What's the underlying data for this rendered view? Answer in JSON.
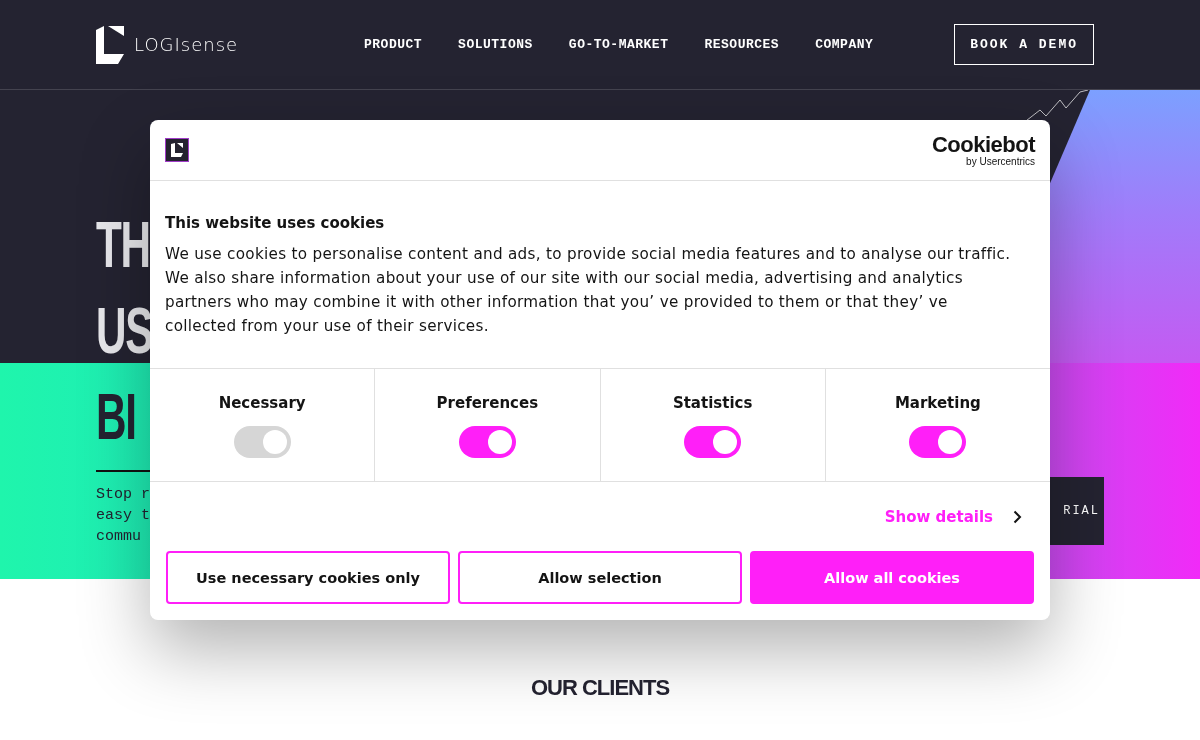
{
  "header": {
    "brand": "LOGIsense",
    "nav": [
      "PRODUCT",
      "SOLUTIONS",
      "GO-TO-MARKET",
      "RESOURCES",
      "COMPANY"
    ],
    "cta": "BOOK A DEMO"
  },
  "hero": {
    "headline": [
      "TH",
      "US",
      "BI"
    ],
    "intro": [
      "Stop r",
      "easy t",
      "commu"
    ],
    "button": "RIAL"
  },
  "clients": {
    "title": "OUR CLIENTS"
  },
  "consent": {
    "brand": {
      "name": "Cookiebot",
      "tagline": "by Usercentrics"
    },
    "title": "This website uses cookies",
    "text": "We use cookies to personalise content and ads, to provide social media features and to analyse our traffic. We also share information about your use of our site with our social media, advertising and analytics partners who may combine it with other information that you’ ve provided to them or that they’ ve collected from your use of their services.",
    "categories": [
      {
        "label": "Necessary",
        "on": true,
        "disabled": true
      },
      {
        "label": "Preferences",
        "on": true,
        "disabled": false
      },
      {
        "label": "Statistics",
        "on": true,
        "disabled": false
      },
      {
        "label": "Marketing",
        "on": true,
        "disabled": false
      }
    ],
    "details_link": "Show details",
    "buttons": [
      {
        "label": "Use necessary cookies only",
        "kind": "outline"
      },
      {
        "label": "Allow selection",
        "kind": "outline"
      },
      {
        "label": "Allow all cookies",
        "kind": "filled"
      }
    ]
  }
}
